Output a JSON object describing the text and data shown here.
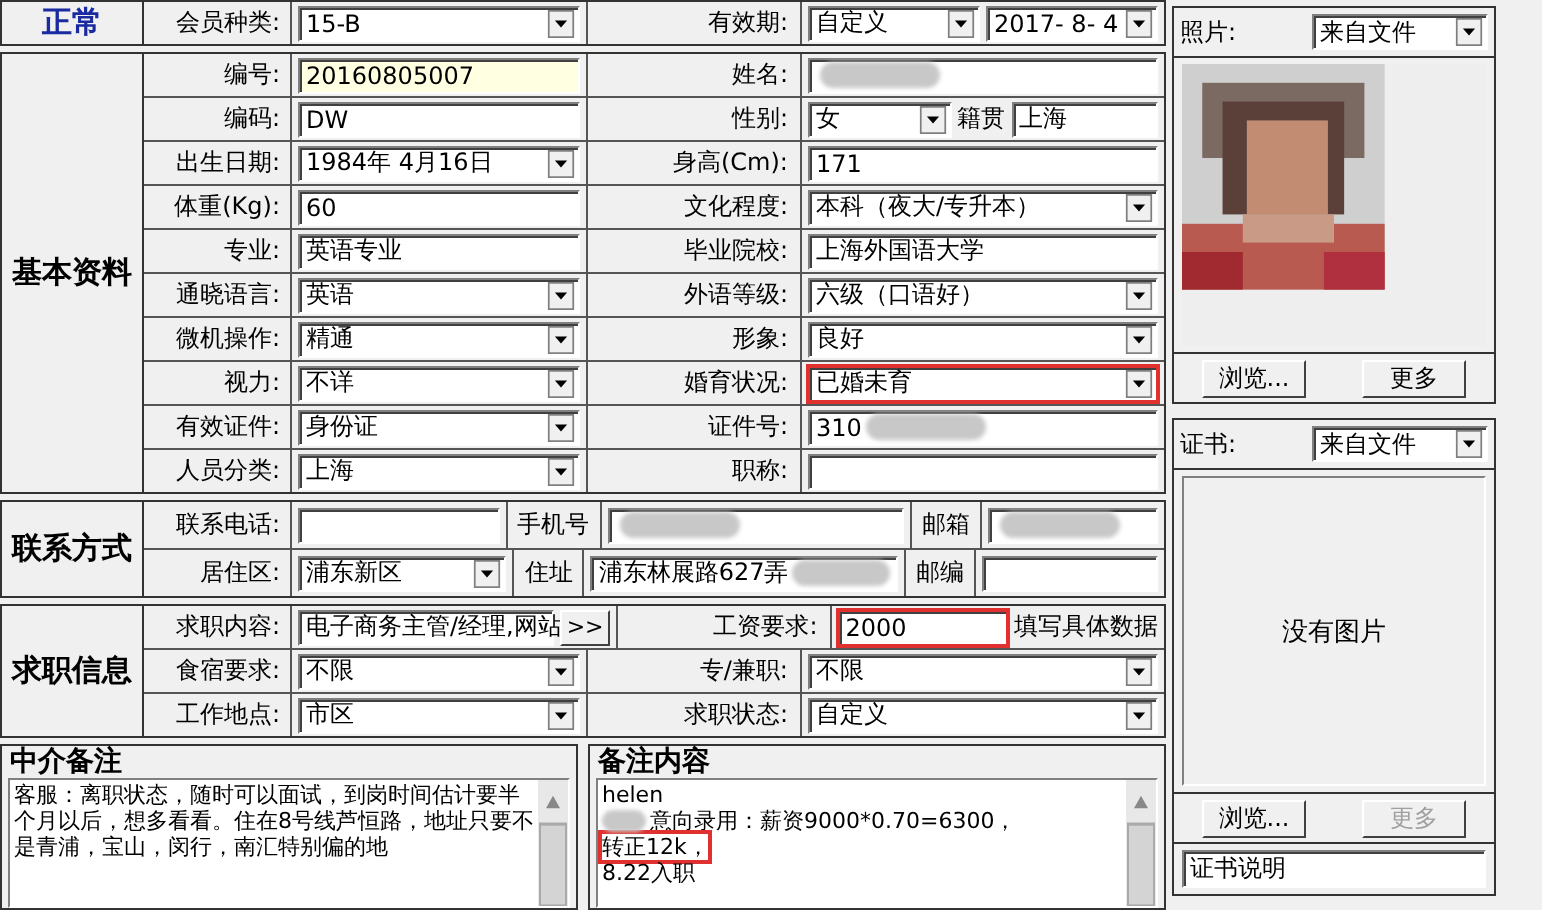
{
  "sections": [
    {
      "title": "正常",
      "kind": "status",
      "rows": [
        {
          "label": "会员种类:",
          "cells": [
            {
              "kind": "field",
              "controls": [
                {
                  "kind": "select",
                  "value": "15-B"
                }
              ]
            },
            {
              "kind": "label",
              "text": "有效期:"
            },
            {
              "kind": "field",
              "controls": [
                {
                  "kind": "select",
                  "value": "自定义"
                },
                {
                  "kind": "select",
                  "value": "2017- 8- 4"
                }
              ]
            }
          ]
        }
      ]
    },
    {
      "title": "基本资料",
      "kind": "basic",
      "rows": [
        {
          "label": "编号:",
          "cells": [
            {
              "kind": "field",
              "controls": [
                {
                  "kind": "input",
                  "value": "20160805007",
                  "readonly": true
                }
              ]
            },
            {
              "kind": "label",
              "text": "姓名:"
            },
            {
              "kind": "field",
              "controls": [
                {
                  "kind": "input",
                  "blurred": true
                }
              ]
            }
          ]
        },
        {
          "label": "编码:",
          "cells": [
            {
              "kind": "field",
              "controls": [
                {
                  "kind": "input",
                  "value": "DW"
                }
              ]
            },
            {
              "kind": "label",
              "text": "性别:"
            },
            {
              "kind": "field",
              "controls": [
                {
                  "kind": "select",
                  "value": "女"
                },
                {
                  "kind": "text",
                  "text": "籍贯"
                },
                {
                  "kind": "input",
                  "value": "上海"
                }
              ]
            }
          ]
        },
        {
          "label": "出生日期:",
          "cells": [
            {
              "kind": "field",
              "controls": [
                {
                  "kind": "select",
                  "value": "1984年 4月16日"
                }
              ]
            },
            {
              "kind": "label",
              "text": "身高(Cm):"
            },
            {
              "kind": "field",
              "controls": [
                {
                  "kind": "input",
                  "value": "171"
                }
              ]
            }
          ]
        },
        {
          "label": "体重(Kg):",
          "cells": [
            {
              "kind": "field",
              "controls": [
                {
                  "kind": "input",
                  "value": "60"
                }
              ]
            },
            {
              "kind": "label",
              "text": "文化程度:"
            },
            {
              "kind": "field",
              "controls": [
                {
                  "kind": "select",
                  "value": "本科（夜大/专升本）"
                }
              ]
            }
          ]
        },
        {
          "label": "专业:",
          "cells": [
            {
              "kind": "field",
              "controls": [
                {
                  "kind": "input",
                  "value": "英语专业"
                }
              ]
            },
            {
              "kind": "label",
              "text": "毕业院校:"
            },
            {
              "kind": "field",
              "controls": [
                {
                  "kind": "input",
                  "value": "上海外国语大学"
                }
              ]
            }
          ]
        },
        {
          "label": "通晓语言:",
          "cells": [
            {
              "kind": "field",
              "controls": [
                {
                  "kind": "select",
                  "value": "英语"
                }
              ]
            },
            {
              "kind": "label",
              "text": "外语等级:"
            },
            {
              "kind": "field",
              "controls": [
                {
                  "kind": "select",
                  "value": "六级（口语好）"
                }
              ]
            }
          ]
        },
        {
          "label": "微机操作:",
          "cells": [
            {
              "kind": "field",
              "controls": [
                {
                  "kind": "select",
                  "value": "精通"
                }
              ]
            },
            {
              "kind": "label",
              "text": "形象:"
            },
            {
              "kind": "field",
              "controls": [
                {
                  "kind": "select",
                  "value": "良好"
                }
              ]
            }
          ]
        },
        {
          "label": "视力:",
          "cells": [
            {
              "kind": "field",
              "controls": [
                {
                  "kind": "select",
                  "value": "不详"
                }
              ]
            },
            {
              "kind": "label",
              "text": "婚育状况:"
            },
            {
              "kind": "field",
              "controls": [
                {
                  "kind": "select",
                  "value": "已婚未育",
                  "highlighted": true
                }
              ]
            }
          ]
        },
        {
          "label": "有效证件:",
          "cells": [
            {
              "kind": "field",
              "controls": [
                {
                  "kind": "select",
                  "value": "身份证"
                }
              ]
            },
            {
              "kind": "label",
              "text": "证件号:"
            },
            {
              "kind": "field",
              "controls": [
                {
                  "kind": "input",
                  "value": "310",
                  "blurred": true
                }
              ]
            }
          ]
        },
        {
          "label": "人员分类:",
          "cells": [
            {
              "kind": "field",
              "controls": [
                {
                  "kind": "select",
                  "value": "上海"
                }
              ]
            },
            {
              "kind": "label",
              "text": "职称:"
            },
            {
              "kind": "field",
              "controls": [
                {
                  "kind": "input"
                }
              ]
            }
          ]
        }
      ]
    },
    {
      "title": "联系方式",
      "kind": "contact",
      "rows": [
        {
          "label": "联系电话:",
          "cells": [
            {
              "kind": "field",
              "controls": [
                {
                  "kind": "input"
                }
              ]
            },
            {
              "kind": "label",
              "text": "手机号"
            },
            {
              "kind": "field",
              "controls": [
                {
                  "kind": "input",
                  "blurred": true
                }
              ]
            },
            {
              "kind": "label",
              "text": "邮箱"
            },
            {
              "kind": "field",
              "controls": [
                {
                  "kind": "input",
                  "blurred": true
                }
              ]
            }
          ]
        },
        {
          "label": "居住区:",
          "cells": [
            {
              "kind": "field",
              "controls": [
                {
                  "kind": "select",
                  "value": "浦东新区"
                }
              ]
            },
            {
              "kind": "label",
              "text": "住址"
            },
            {
              "kind": "field",
              "controls": [
                {
                  "kind": "input",
                  "value": "浦东林展路627弄",
                  "blurred": true
                }
              ]
            },
            {
              "kind": "label",
              "text": "邮编"
            },
            {
              "kind": "field",
              "controls": [
                {
                  "kind": "input"
                }
              ]
            }
          ]
        }
      ]
    },
    {
      "title": "求职信息",
      "kind": "job",
      "rows": [
        {
          "label": "求职内容:",
          "cells": [
            {
              "kind": "field",
              "controls": [
                {
                  "kind": "input",
                  "value": "电子商务主管/经理,网站"
                },
                {
                  "kind": "button",
                  "text": ">>"
                }
              ]
            },
            {
              "kind": "label",
              "text": "工资要求:"
            },
            {
              "kind": "field",
              "controls": [
                {
                  "kind": "input",
                  "value": "2000",
                  "highlighted": true
                },
                {
                  "kind": "text",
                  "text": "填写具体数据"
                }
              ]
            }
          ]
        },
        {
          "label": "食宿要求:",
          "cells": [
            {
              "kind": "field",
              "controls": [
                {
                  "kind": "select",
                  "value": "不限"
                }
              ]
            },
            {
              "kind": "label",
              "text": "专/兼职:"
            },
            {
              "kind": "field",
              "controls": [
                {
                  "kind": "select",
                  "value": "不限"
                }
              ]
            }
          ]
        },
        {
          "label": "工作地点:",
          "cells": [
            {
              "kind": "field",
              "controls": [
                {
                  "kind": "select",
                  "value": "市区"
                }
              ]
            },
            {
              "kind": "label",
              "text": "求职状态:"
            },
            {
              "kind": "field",
              "controls": [
                {
                  "kind": "select",
                  "value": "自定义"
                }
              ]
            }
          ]
        }
      ]
    }
  ],
  "remarks": [
    {
      "title": "中介备注",
      "lines": [
        {
          "segments": [
            {
              "text": "客服：离职状态，随时可以面试，到岗时间估计要半个月以后，想多看看。住在8号线芦恒路，地址只要不是青浦，宝山，闵行，南汇特别偏的地"
            }
          ]
        }
      ]
    },
    {
      "title": "备注内容",
      "lines": [
        {
          "segments": [
            {
              "text": "helen"
            }
          ]
        },
        {
          "blurred": true,
          "segments": [
            {
              "text": "意向录用：薪资9000*0.70=6300，"
            },
            {
              "text": "转正12k，",
              "highlighted": true
            }
          ]
        },
        {
          "segments": [
            {
              "text": "8.22入职"
            }
          ]
        }
      ]
    }
  ],
  "panels": [
    {
      "label": "照片:",
      "source": "来自文件",
      "buttons": [
        {
          "text": "浏览...",
          "disabled": false
        },
        {
          "text": "更多",
          "disabled": false
        }
      ]
    },
    {
      "kind": "certificate",
      "label": "证书:",
      "source": "来自文件",
      "empty_text": "没有图片",
      "buttons": [
        {
          "text": "浏览...",
          "disabled": false
        },
        {
          "text": "更多",
          "disabled": true
        }
      ],
      "caption": "证书说明"
    }
  ]
}
